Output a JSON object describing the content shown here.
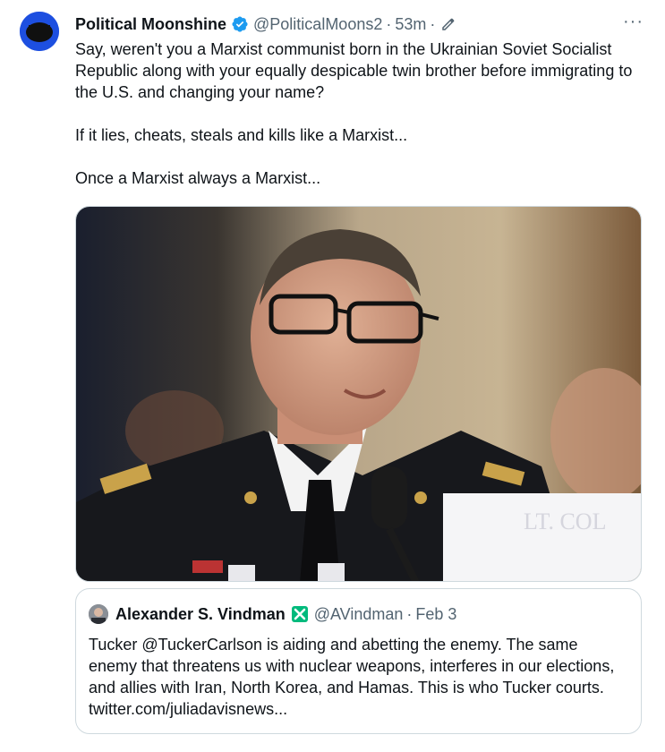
{
  "tweet": {
    "author_name": "Political Moonshine",
    "handle": "@PoliticalMoons2",
    "time": "53m",
    "dot": "·",
    "more_label": "···",
    "paragraphs": [
      "Say, weren't you a Marxist communist born in the Ukrainian Soviet Socialist Republic along with your equally despicable twin brother before immigrating to the U.S. and changing your name?",
      "If it lies, cheats, steals and kills like a Marxist...",
      "Once a Marxist always a Marxist..."
    ],
    "icons": {
      "verified": "verified-badge-icon",
      "edit": "edit-pencil-icon",
      "more": "more-dots-icon"
    },
    "colors": {
      "verified": "#1d9bf0",
      "muted": "#536471",
      "avatar_bg": "#1d4fe0"
    }
  },
  "quote": {
    "author_name": "Alexander S. Vindman",
    "handle": "@AVindman",
    "date": "Feb 3",
    "dot": "·",
    "text": "Tucker @TuckerCarlson is aiding and abetting the enemy. The same enemy that threatens us with nuclear weapons, interferes in our elections, and allies with Iran, North Korea, and Hamas. This is who Tucker courts. twitter.com/juliadavisnews...",
    "icons": {
      "verified": "green-x-checkmark-icon"
    },
    "colors": {
      "check": "#00ba7c"
    }
  }
}
